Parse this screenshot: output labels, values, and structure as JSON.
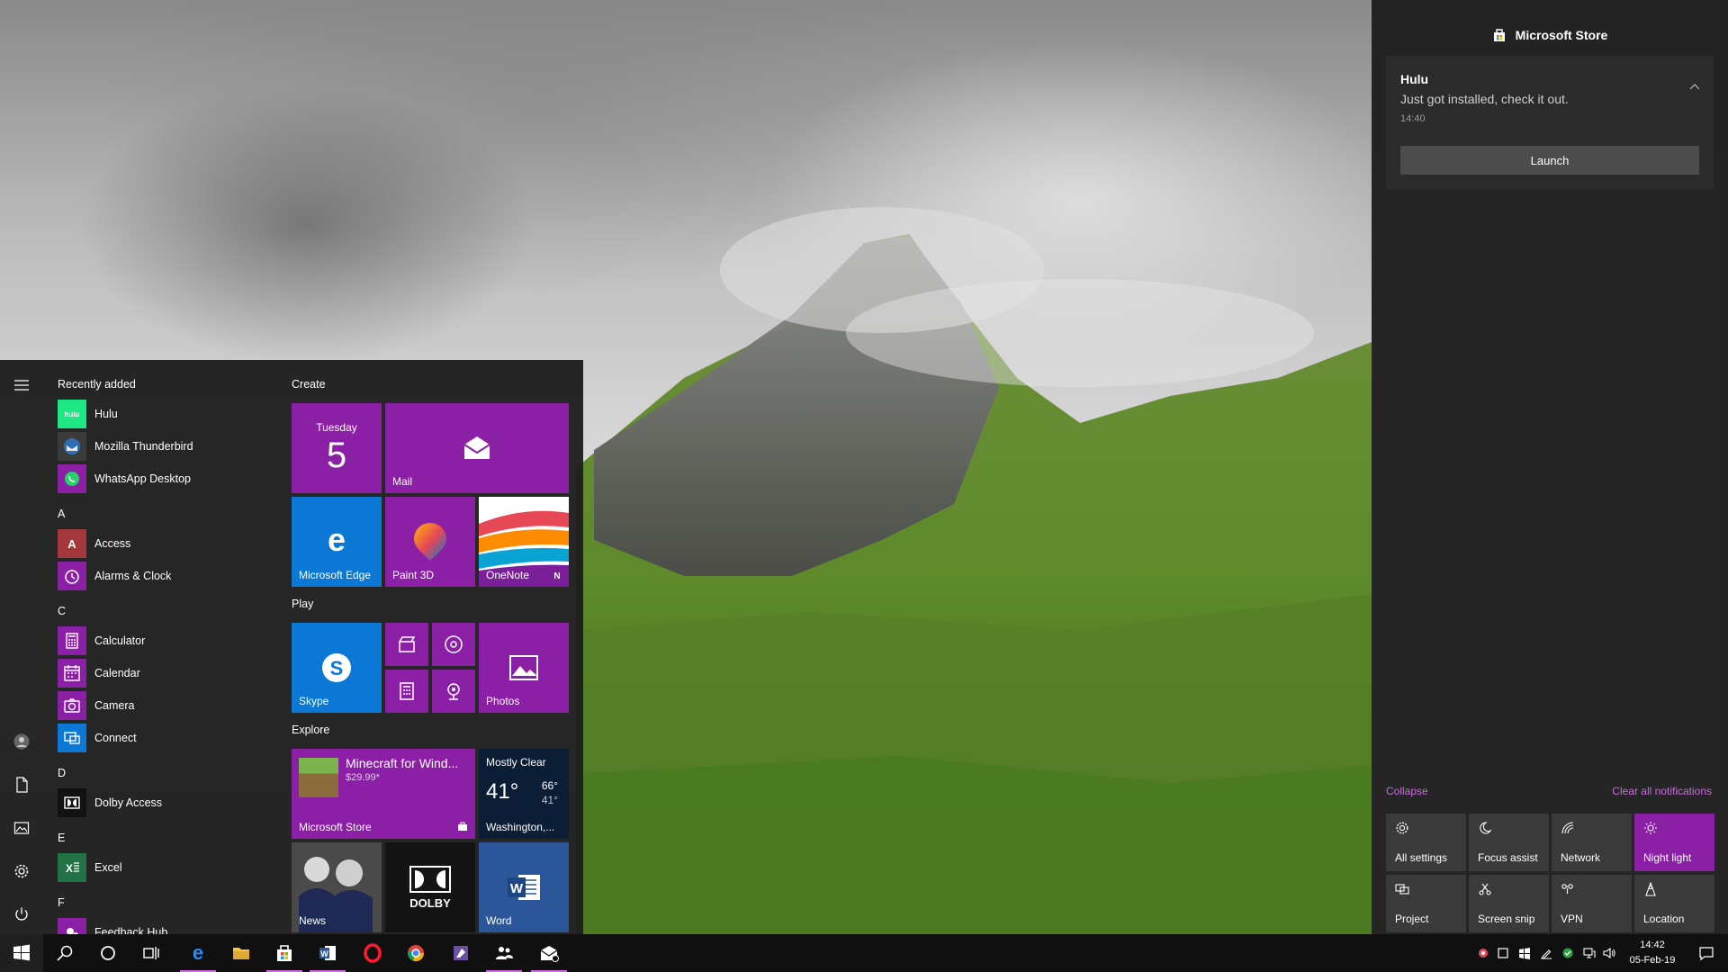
{
  "start_menu": {
    "recently_added_heading": "Recently added",
    "recent_apps": [
      {
        "label": "Hulu",
        "icon": "hulu-icon",
        "color": "#1ce783"
      },
      {
        "label": "Mozilla Thunderbird",
        "icon": "thunderbird-icon",
        "color": "#2d6fb5"
      },
      {
        "label": "WhatsApp Desktop",
        "icon": "whatsapp-icon",
        "color": "#25d366"
      }
    ],
    "sections": [
      {
        "letter": "A",
        "apps": [
          {
            "label": "Access",
            "icon": "access-icon",
            "color": "#a4373a"
          },
          {
            "label": "Alarms & Clock",
            "icon": "alarm-clock-icon",
            "color": "#8b1fa6"
          }
        ]
      },
      {
        "letter": "C",
        "apps": [
          {
            "label": "Calculator",
            "icon": "calculator-icon",
            "color": "#8b1fa6"
          },
          {
            "label": "Calendar",
            "icon": "calendar-icon",
            "color": "#8b1fa6"
          },
          {
            "label": "Camera",
            "icon": "camera-icon",
            "color": "#8b1fa6"
          },
          {
            "label": "Connect",
            "icon": "connect-icon",
            "color": "#0a78d4"
          }
        ]
      },
      {
        "letter": "D",
        "apps": [
          {
            "label": "Dolby Access",
            "icon": "dolby-icon",
            "color": "#111111"
          }
        ]
      },
      {
        "letter": "E",
        "apps": [
          {
            "label": "Excel",
            "icon": "excel-icon",
            "color": "#217346"
          }
        ]
      },
      {
        "letter": "F",
        "apps": [
          {
            "label": "Feedback Hub",
            "icon": "feedback-hub-icon",
            "color": "#8b1fa6"
          }
        ]
      }
    ],
    "groups": {
      "create": "Create",
      "play": "Play",
      "explore": "Explore"
    },
    "tiles": {
      "calendar_day": "Tuesday",
      "calendar_date": "5",
      "mail": "Mail",
      "edge": "Microsoft Edge",
      "paint3d": "Paint 3D",
      "onenote": "OneNote",
      "skype": "Skype",
      "photos": "Photos",
      "store_title": "Minecraft for Wind...",
      "store_price": "$29.99*",
      "store_label": "Microsoft Store",
      "weather_condition": "Mostly Clear",
      "weather_temp": "41°",
      "weather_high": "66°",
      "weather_low": "41°",
      "weather_location": "Washington,...",
      "news": "News",
      "dolby": "DOLBY",
      "word": "Word"
    }
  },
  "action_center": {
    "app_name": "Microsoft Store",
    "notification": {
      "title": "Hulu",
      "body": "Just got installed, check it out.",
      "time": "14:40",
      "button": "Launch"
    },
    "collapse": "Collapse",
    "clear_all": "Clear all notifications",
    "quick_actions": [
      {
        "label": "All settings",
        "icon": "gear-icon",
        "on": false
      },
      {
        "label": "Focus assist",
        "icon": "moon-icon",
        "on": false
      },
      {
        "label": "Network",
        "icon": "network-icon",
        "on": false
      },
      {
        "label": "Night light",
        "icon": "sun-icon",
        "on": true
      },
      {
        "label": "Project",
        "icon": "project-icon",
        "on": false
      },
      {
        "label": "Screen snip",
        "icon": "screen-snip-icon",
        "on": false
      },
      {
        "label": "VPN",
        "icon": "vpn-icon",
        "on": false
      },
      {
        "label": "Location",
        "icon": "location-icon",
        "on": false
      }
    ]
  },
  "taskbar": {
    "clock_time": "14:42",
    "clock_date": "05-Feb-19"
  },
  "colors": {
    "accent": "#8b1fa6",
    "accent_link": "#c96bdf",
    "tile_blue": "#0a78d4"
  }
}
